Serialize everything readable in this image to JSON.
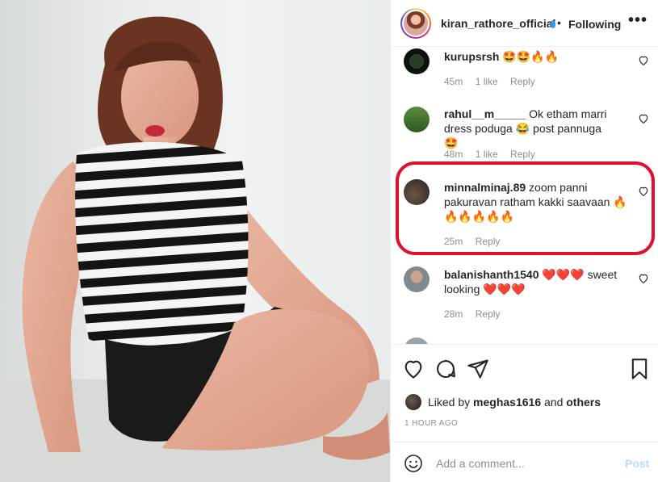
{
  "post": {
    "username": "kiran_rathore_official",
    "following_label": "Following",
    "separator": "•",
    "more_label": "•••"
  },
  "comments": [
    {
      "user": "kurupsrsh",
      "text": " 🤩🤩🔥🔥",
      "time": "45m",
      "likes": "1 like",
      "reply": "Reply"
    },
    {
      "user": "rahul__m_____",
      "text": " Ok etham marri dress poduga 😂 post pannuga 🤩",
      "time": "48m",
      "likes": "1 like",
      "reply": "Reply"
    },
    {
      "user": "minnalminaj.89",
      "text": " zoom panni pakuravan ratham kakki saavaan 🔥🔥🔥🔥🔥🔥",
      "time": "25m",
      "reply": "Reply"
    },
    {
      "user": "balanishanth1540",
      "text": " ❤️❤️❤️ sweet looking ❤️❤️❤️",
      "time": "28m",
      "reply": "Reply"
    }
  ],
  "likes": {
    "prefix": "Liked by ",
    "user": "meghas1616",
    "middle": " and ",
    "others": "others"
  },
  "timestamp": "1 HOUR AGO",
  "add_comment": {
    "placeholder": "Add a comment...",
    "post_label": "Post"
  },
  "colors": {
    "highlight": "#e0102c",
    "verified": "#3897f0",
    "post_disabled": "#b2dffc"
  }
}
